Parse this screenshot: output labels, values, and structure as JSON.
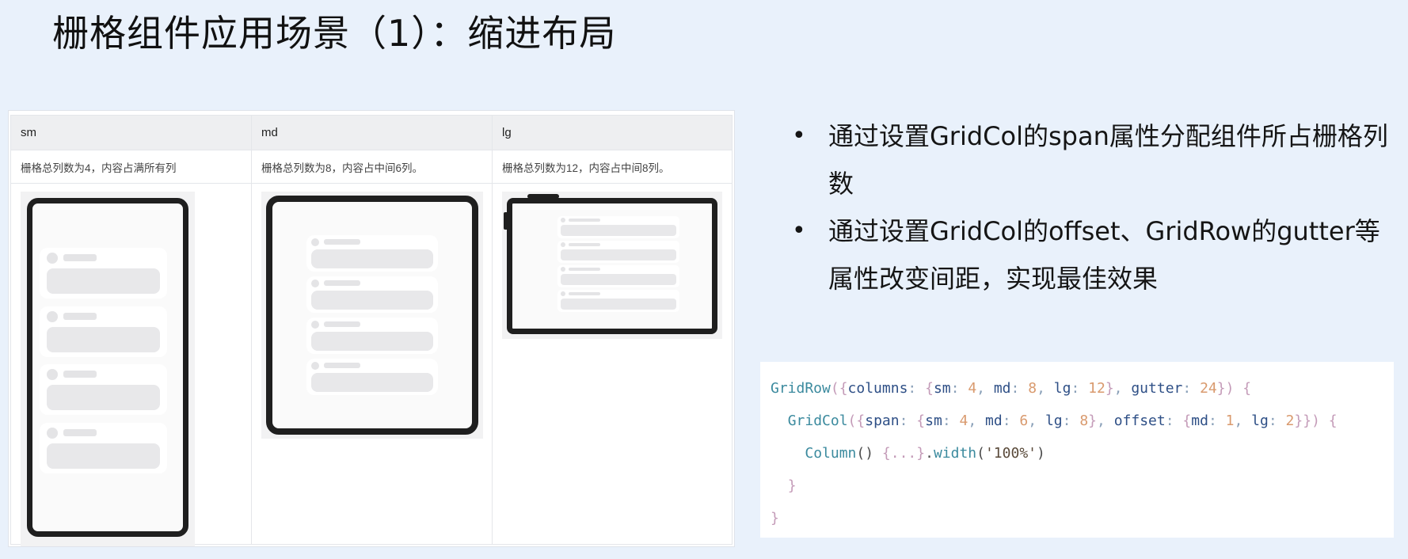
{
  "title": "栅格组件应用场景（1）：缩进布局",
  "table": {
    "headers": [
      "sm",
      "md",
      "lg"
    ],
    "descriptions": [
      "栅格总列数为4，内容占满所有列",
      "栅格总列数为8，内容占中间6列。",
      "栅格总列数为12，内容占中间8列。"
    ]
  },
  "bullets": [
    "通过设置GridCol的span属性分配组件所占栅格列数",
    "通过设置GridCol的offset、GridRow的gutter等属性改变间距，实现最佳效果"
  ],
  "code": {
    "line1": {
      "fn": "GridRow",
      "p1": "(",
      "b1": "{",
      "k1": "columns",
      "c1": ": ",
      "b2": "{",
      "k2": "sm",
      "c2": ": ",
      "n1": "4",
      "s1": ", ",
      "k3": "md",
      "c3": ": ",
      "n2": "8",
      "s2": ", ",
      "k4": "lg",
      "c4": ": ",
      "n3": "12",
      "b3": "}",
      "s3": ", ",
      "k5": "gutter",
      "c5": ": ",
      "n4": "24",
      "b4": "}",
      "p2": ") ",
      "b5": "{"
    },
    "line2": {
      "fn": "GridCol",
      "p1": "(",
      "b1": "{",
      "k1": "span",
      "c1": ": ",
      "b2": "{",
      "k2": "sm",
      "c2": ": ",
      "n1": "4",
      "s1": ", ",
      "k3": "md",
      "c3": ": ",
      "n2": "6",
      "s2": ", ",
      "k4": "lg",
      "c4": ": ",
      "n3": "8",
      "b3": "}",
      "s3": ", ",
      "k5": "offset",
      "c5": ": ",
      "b4": "{",
      "k6": "md",
      "c6": ": ",
      "n4": "1",
      "s4": ", ",
      "k7": "lg",
      "c7": ": ",
      "n5": "2",
      "b5": "}}",
      "p2": ") ",
      "b6": "{"
    },
    "line3": {
      "fn": "Column",
      "p1": "() ",
      "b1": "{...}",
      "p2": ".",
      "fn2": "width",
      "p3": "(",
      "str": "'100%'",
      "p4": ")"
    },
    "line4": "}",
    "line5": "}"
  },
  "colors": {
    "background": "#e9f1fb",
    "code_function": "#3b8a9e",
    "code_key": "#2e4f86",
    "code_number": "#d99a6e",
    "code_brace": "#c49bb8"
  }
}
